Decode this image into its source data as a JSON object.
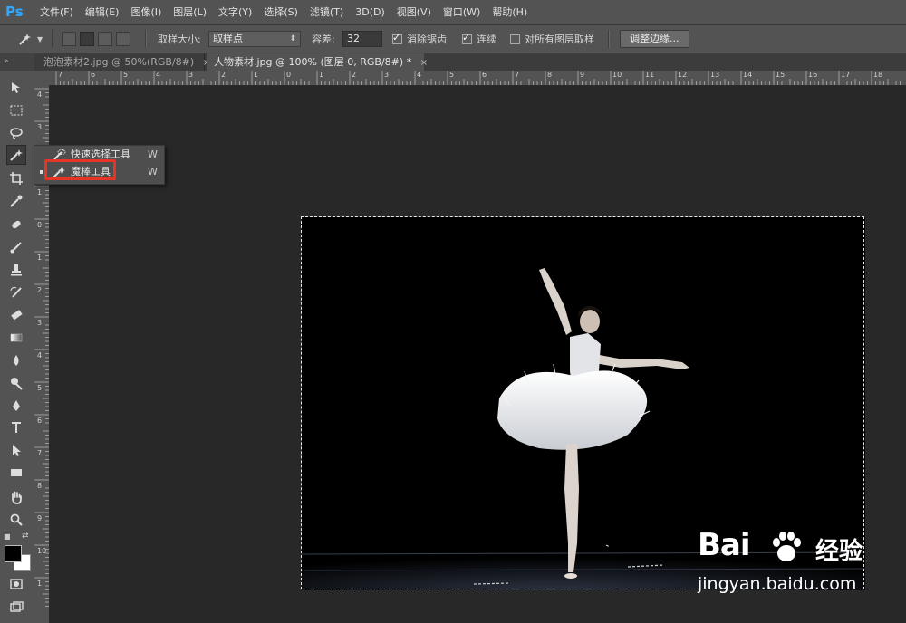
{
  "app": {
    "logo": "Ps",
    "accent": "#31a8ff"
  },
  "menu": [
    "文件(F)",
    "编辑(E)",
    "图像(I)",
    "图层(L)",
    "文字(Y)",
    "选择(S)",
    "滤镜(T)",
    "3D(D)",
    "视图(V)",
    "窗口(W)",
    "帮助(H)"
  ],
  "options": {
    "sample_size_label": "取样大小:",
    "sample_size_value": "取样点",
    "tolerance_label": "容差:",
    "tolerance_value": "32",
    "antialias_label": "消除锯齿",
    "antialias_checked": true,
    "contiguous_label": "连续",
    "contiguous_checked": true,
    "all_layers_label": "对所有图层取样",
    "all_layers_checked": false,
    "refine_edge_label": "调整边缘..."
  },
  "tabs": [
    {
      "label": "泡泡素材2.jpg @ 50%(RGB/8#)",
      "close": "×",
      "active": false
    },
    {
      "label": "人物素材.jpg @ 100% (图层 0, RGB/8#) *",
      "close": "×",
      "active": true
    }
  ],
  "panel_collapse": "»",
  "ruler_top": [
    "7",
    "6",
    "5",
    "4",
    "3",
    "2",
    "1",
    "0",
    "1",
    "2",
    "3",
    "4",
    "5",
    "6",
    "7",
    "8",
    "9",
    "10",
    "11",
    "12",
    "13",
    "14",
    "15",
    "16",
    "17",
    "18"
  ],
  "ruler_left": [
    "4",
    "3",
    "2",
    "1",
    "0",
    "1",
    "2",
    "3",
    "4",
    "5",
    "6",
    "7",
    "8",
    "9",
    "10",
    "1"
  ],
  "flyout": {
    "items": [
      {
        "label": "快速选择工具",
        "key": "W",
        "icon": "quick-selection-icon",
        "selected": false
      },
      {
        "label": "魔棒工具",
        "key": "W",
        "icon": "magic-wand-icon",
        "selected": true
      }
    ],
    "highlight_color": "#e5342a"
  },
  "watermark": {
    "brand_latin_1": "Bai",
    "brand_latin_2": "du",
    "brand_cn": "经验",
    "url": "jingyan.baidu.com"
  }
}
